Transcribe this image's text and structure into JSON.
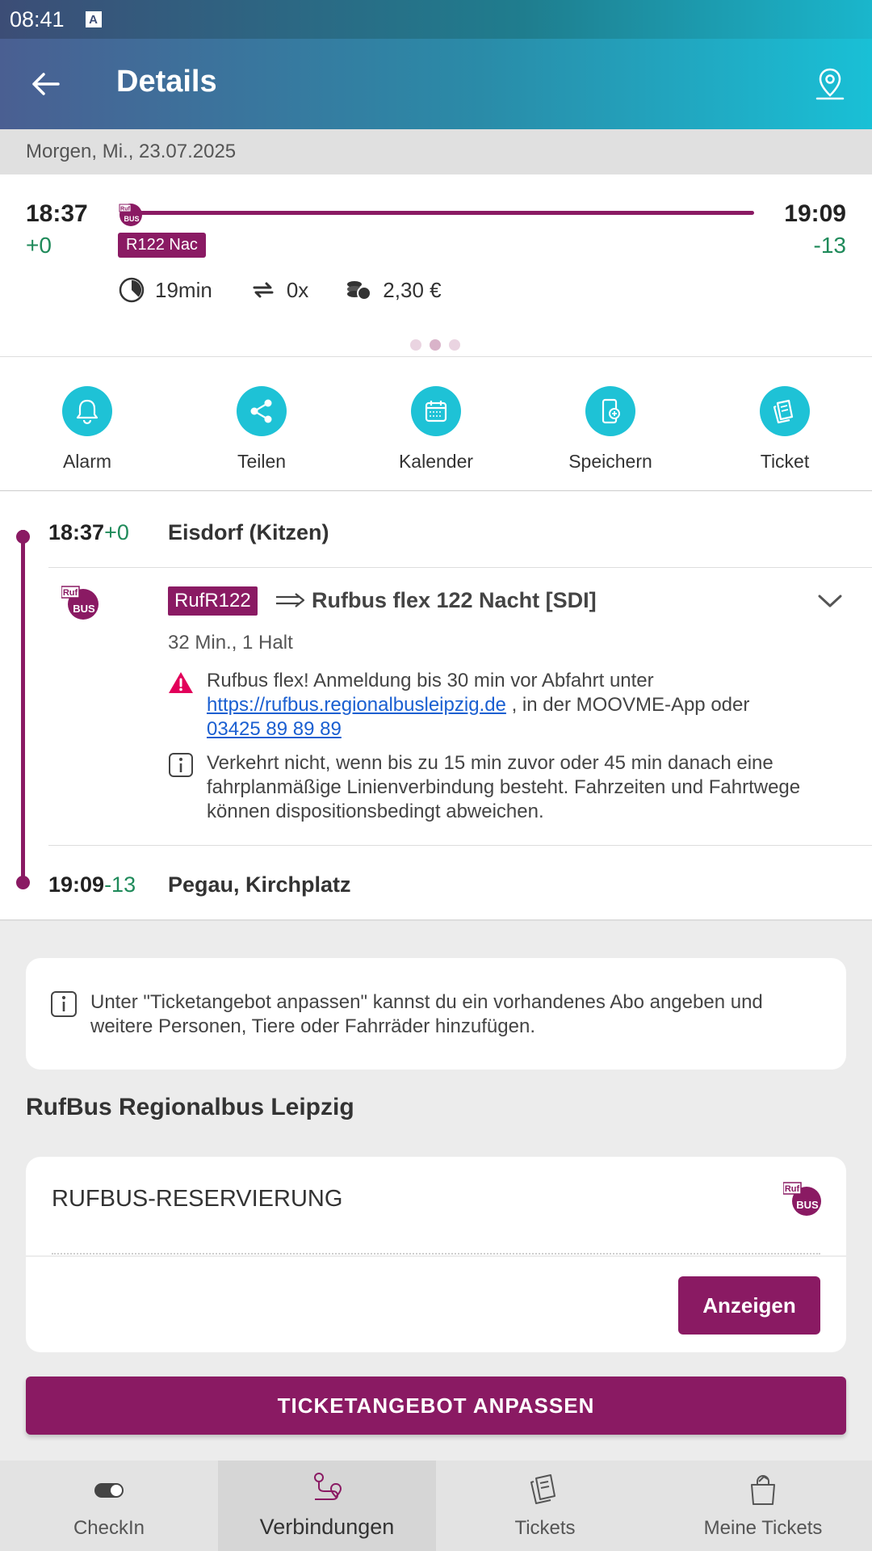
{
  "status": {
    "time": "08:41",
    "indicator": "A"
  },
  "appbar": {
    "title": "Details",
    "back_icon": "back-arrow-icon",
    "map_icon": "map-pin-icon"
  },
  "date_label": "Morgen, Mi., 23.07.2025",
  "summary": {
    "dep_time": "18:37",
    "dep_delay": "+0",
    "arr_time": "19:09",
    "arr_delay": "-13",
    "line_badge": "R122 Nac",
    "duration": "19min",
    "changes": "0x",
    "price": "2,30 €"
  },
  "actions": [
    {
      "label": "Alarm",
      "icon": "bell-icon"
    },
    {
      "label": "Teilen",
      "icon": "share-icon"
    },
    {
      "label": "Kalender",
      "icon": "calendar-icon"
    },
    {
      "label": "Speichern",
      "icon": "save-phone-icon"
    },
    {
      "label": "Ticket",
      "icon": "ticket-icon"
    }
  ],
  "journey": {
    "start": {
      "time": "18:37",
      "delay": "+0",
      "name": "Eisdorf (Kitzen)"
    },
    "leg": {
      "badge": "RufR122",
      "name": "Rufbus flex 122 Nacht [SDI]",
      "duration": "32 Min., 1 Halt",
      "warning_pre": "Rufbus flex! Anmeldung bis 30 min vor Abfahrt unter",
      "warning_link": "https://rufbus.regionalbusleipzig.de",
      "warning_mid": ", in der MOOVME-App oder",
      "warning_phone": "03425 89 89 89",
      "info": "Verkehrt nicht, wenn bis zu 15 min zuvor oder 45 min danach eine fahrplanmäßige Linienverbindung besteht. Fahrzeiten und Fahrtwege können dispositionsbedingt abweichen."
    },
    "end": {
      "time": "19:09",
      "delay": "-13",
      "name": "Pegau, Kirchplatz"
    }
  },
  "info_card": "Unter \"Ticketangebot anpassen\" kannst du ein vorhandenes Abo angeben und weitere Personen, Tiere oder Fahrräder hinzufügen.",
  "operator_title": "RufBus Regionalbus Leipzig",
  "reservation": {
    "label": "RUFBUS-RESERVIERUNG",
    "button": "Anzeigen"
  },
  "cta": "TICKETANGEBOT ANPASSEN",
  "bottom_nav": [
    {
      "label": "CheckIn",
      "icon": "toggle-icon"
    },
    {
      "label": "Verbindungen",
      "icon": "route-icon"
    },
    {
      "label": "Tickets",
      "icon": "tickets-icon"
    },
    {
      "label": "Meine Tickets",
      "icon": "shopping-bag-icon"
    }
  ],
  "colors": {
    "primary": "#8a1a63",
    "accent": "#1ec2d6",
    "delay_ok": "#1f8a5a",
    "warning": "#e2005a",
    "link": "#1a5fd1"
  }
}
